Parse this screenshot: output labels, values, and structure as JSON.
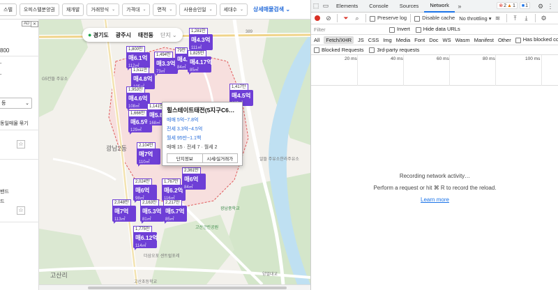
{
  "filterbar": {
    "chips": [
      "스텔",
      "오피스텔분양권",
      "재개발"
    ],
    "dropdowns": [
      "거래방식",
      "가격대",
      "면적",
      "사용승인일",
      "세대수"
    ],
    "detail_search": "상세매물검색"
  },
  "leftpanel": {
    "ad": "AD",
    "ad_close": "✕",
    "price": "800",
    "dots": [
      "-",
      "-"
    ],
    "select_value": "등",
    "same_listing": "동일매물 묶기",
    "side_snippets": [
      "밴드",
      "드"
    ]
  },
  "location": {
    "province": "경기도",
    "city": "광주시",
    "dong": "태전동",
    "unit": "단지"
  },
  "map_labels": {
    "district": "광남2동",
    "district2": "고산리",
    "road": "389",
    "school_top": "G5칸뜰\n주유소",
    "bldg1": "알뜰\n주유소한라주유소",
    "school": "광남중학교",
    "park": "고산근린공원",
    "fuel": "더삼오포\n센트럴포레",
    "elem": "고산초등학교",
    "bridge": "양벌대교"
  },
  "markers": [
    {
      "count": "1,800만",
      "price": "매6.1억",
      "area": "112㎡"
    },
    {
      "count": "1,494만",
      "price": "매3.3억",
      "area": "73㎡"
    },
    {
      "count": "79만",
      "price": "매4.1억",
      "area": "84㎡"
    },
    {
      "count": "1,281만",
      "price": "매4.3억",
      "area": "111㎡"
    },
    {
      "count": "1,825만",
      "price": "매4.17억",
      "area": "85㎡"
    },
    {
      "count": "1,511만",
      "price": "매4.8억",
      "area": "105㎡"
    },
    {
      "count": "1,417만",
      "price": "매4.5억",
      "area": "105㎡"
    },
    {
      "count": "1,953만",
      "price": "매4.6억",
      "area": "108㎡"
    },
    {
      "count": "1,666만",
      "price": "매6.5억",
      "area": "129㎡"
    },
    {
      "count": "1,141만",
      "price": "매5.8억",
      "area": "168㎡"
    },
    {
      "count": "2,104만",
      "price": "매7억",
      "area": "110㎡"
    },
    {
      "count": "2,024만",
      "price": "매6억",
      "area": "98㎡"
    },
    {
      "count": "1,767만",
      "price": "매6.2억",
      "area": "116㎡"
    },
    {
      "count": "2,361만",
      "price": "매6억",
      "area": "84㎡"
    },
    {
      "count": "2,048만",
      "price": "매7억",
      "area": "113㎡"
    },
    {
      "count": "2,163만",
      "price": "매5.3억",
      "area": "81㎡"
    },
    {
      "count": "2,217만",
      "price": "매5.7억",
      "area": "85㎡"
    },
    {
      "count": "1,775만",
      "price": "매6.12억",
      "area": "114㎡"
    }
  ],
  "popup": {
    "title": "힐스테이트태전(5지구C6…",
    "sale": "매매 5억~7.8억",
    "jeonse": "전세 3.3억~4.5억",
    "monthly": "월세 95만~1.1백",
    "counts": "매매 15 · 전세 7 · 월세 2",
    "btn_info": "단지정보",
    "btn_price": "시세/실거래가"
  },
  "devtools": {
    "tabs": [
      "Elements",
      "Console",
      "Sources",
      "Network"
    ],
    "active_tab": "Network",
    "errors": "2",
    "warnings": "1",
    "issues": "1",
    "preserve_log": "Preserve log",
    "disable_cache": "Disable cache",
    "throttling": "No throttling",
    "filter_placeholder": "Filter",
    "invert": "Invert",
    "hide_data_urls": "Hide data URLs",
    "types": [
      "All",
      "Fetch/XHR",
      "JS",
      "CSS",
      "Img",
      "Media",
      "Font",
      "Doc",
      "WS",
      "Wasm",
      "Manifest",
      "Other"
    ],
    "active_type": "Fetch/XHR",
    "has_blocked_cookies": "Has blocked cookies",
    "blocked_requests": "Blocked Requests",
    "third_party": "3rd-party requests",
    "ticks": [
      "20 ms",
      "40 ms",
      "60 ms",
      "80 ms",
      "100 ms"
    ],
    "empty_line1": "Recording network activity…",
    "empty_line2": "Perform a request or hit ⌘ R to record the reload.",
    "learn_more": "Learn more"
  }
}
